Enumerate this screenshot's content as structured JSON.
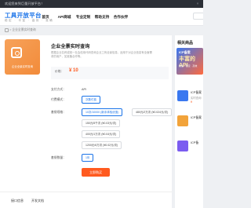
{
  "topbar": {
    "text": "欢迎您来到巨量开放平台！",
    "close": "×"
  },
  "header": {
    "logo_title": "工具开放平台",
    "logo_sub": "稳定 · 丰富 · 高效 · 准确",
    "nav": [
      "首页",
      "API商城",
      "专业定制",
      "帮助支持",
      "合作伙伴"
    ]
  },
  "breadcrumb": {
    "sep": ">",
    "current": "企业全景实时查询"
  },
  "product": {
    "thumb_caption": "企业全景实时查询",
    "title": "企业全景实时查询",
    "desc": "根据企业名称或统一社会信用代码查询企业工商全景信息，适用于对企业信息有全面需求的用户，如准备合作等。",
    "price_label": "价格：",
    "price": "¥ 10"
  },
  "rows": {
    "pay_label": "支付方式：",
    "pay_value": "API",
    "mode_label": "付费模式：",
    "mode_value": "次数付费",
    "pack_label": "套餐规格：",
    "qty_label": "套餐数量："
  },
  "packages": [
    "10次/10000 (新手体验优惠)",
    "480元/2万次 (¥0.024元/次)",
    "150元/5千次 (¥0.03元/次)",
    "400元/1万次 (¥0.04元/次)",
    "1200元/6万次 (¥0.02元/次)"
  ],
  "qty_value": "1年",
  "buy_label": "立即购买",
  "footer": {
    "tabs": [
      "接口信息",
      "开发文档"
    ]
  },
  "side": {
    "title": "相关商品",
    "ad_t1": "ICP备案",
    "ad_t2": "丰富的API",
    "ad_t3": "快速 · 稳定 · 高效",
    "related": [
      {
        "name": "ICP备案",
        "sub": "实时查询",
        "price": "¥"
      },
      {
        "name": "ICP备案",
        "sub": "",
        "price": ""
      },
      {
        "name": "ICP备",
        "sub": "",
        "price": ""
      }
    ]
  }
}
